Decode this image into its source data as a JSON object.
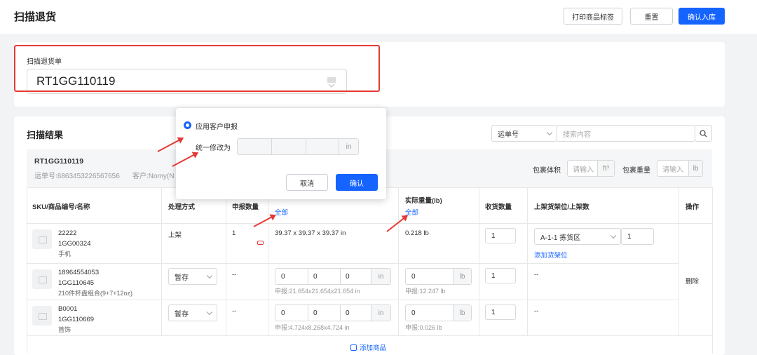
{
  "header": {
    "title": "扫描退货",
    "print_label": "打印商品标签",
    "reset_label": "重置",
    "confirm_label": "确认入库"
  },
  "scan": {
    "label": "扫描退货单",
    "value": "RT1GG110119"
  },
  "results": {
    "title": "扫描结果",
    "search_type": "运单号",
    "search_placeholder": "搜索内容",
    "order": {
      "id": "RT1GG110119",
      "tracking_line": "运单号:6863453226567656",
      "customer_line": "客户:Nomy(N"
    },
    "pkg_volume_label": "包裹体积",
    "pkg_volume_placeholder": "请输入",
    "pkg_volume_unit": "ft³",
    "pkg_weight_label": "包裹重量",
    "pkg_weight_placeholder": "请输入",
    "pkg_weight_unit": "lb",
    "columns": {
      "sku": "SKU/商品编号/名称",
      "process": "处理方式",
      "declared_qty": "申报数量",
      "actual_weight": "实际重量(lb)",
      "received_qty": "收货数量",
      "shelf": "上架货架位/上架数",
      "action": "操作"
    },
    "all_link": "全部",
    "rows": [
      {
        "sku": "22222",
        "code": "1GG00324",
        "name": "手机",
        "process": "上架",
        "declared": "1",
        "dims": "39.37 x 39.37 x 39.37 in",
        "weight": "0.218 lb",
        "received": "1",
        "shelf": "A-1-1 拣货区",
        "shelf_qty": "1",
        "add_shelf": "添加货架位"
      },
      {
        "sku": "18964554053",
        "code": "1GG110645",
        "name": "210件杯盘组合(9+7+12oz)",
        "process": "暂存",
        "declared": "--",
        "dim_l": "0",
        "dim_w": "0",
        "dim_h": "0",
        "dim_unit": "in",
        "dims_decl": "申报:21.654x21.654x21.654 in",
        "weight_val": "0",
        "weight_unit": "lb",
        "weight_decl": "申报:12.247 lb",
        "received": "1",
        "shelf": "--"
      },
      {
        "sku": "B0001",
        "code": "1GG110669",
        "name": "首饰",
        "process": "暂存",
        "declared": "--",
        "dim_l": "0",
        "dim_w": "0",
        "dim_h": "0",
        "dim_unit": "in",
        "dims_decl": "申报:4.724x8.268x4.724 in",
        "weight_val": "0",
        "weight_unit": "lb",
        "weight_decl": "申报:0.026 lb",
        "received": "1",
        "shelf": "--"
      }
    ],
    "delete_label": "删除",
    "add_item": "添加商品"
  },
  "popup": {
    "radio_label": "应用客户申报",
    "modify_label": "统一修改为",
    "unit": "in",
    "cancel": "取消",
    "confirm": "确认"
  }
}
